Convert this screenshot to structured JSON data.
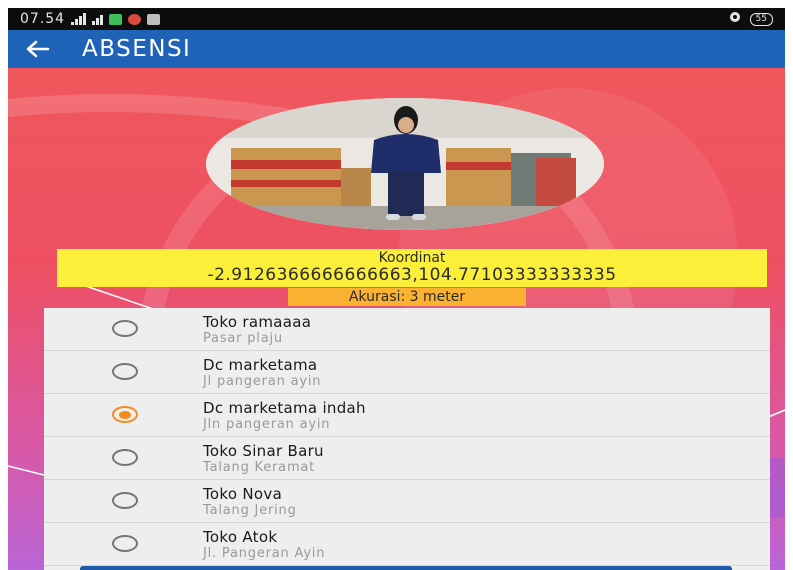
{
  "status_bar": {
    "time": "07.54",
    "battery": "55"
  },
  "app_bar": {
    "title": "ABSENSI"
  },
  "location": {
    "coord_label": "Koordinat",
    "coord_value": "-2.9126366666666663,104.77103333333335",
    "accuracy": "Akurasi: 3 meter"
  },
  "stores": [
    {
      "name": "Toko ramaaaa",
      "address": "Pasar plaju",
      "selected": false
    },
    {
      "name": "Dc marketama",
      "address": "Jl pangeran ayin",
      "selected": false
    },
    {
      "name": "Dc marketama indah",
      "address": "Jln pangeran ayin",
      "selected": true
    },
    {
      "name": "Toko Sinar Baru",
      "address": "Talang Keramat",
      "selected": false
    },
    {
      "name": "Toko Nova",
      "address": "Talang Jering",
      "selected": false
    },
    {
      "name": "Toko Atok",
      "address": "Jl. Pangeran Ayin",
      "selected": false
    }
  ],
  "colors": {
    "app_bar": "#1e63b8",
    "coord_bg": "#fcef3a",
    "accuracy_bg": "#fbb233",
    "radio_selected": "#f58a1e"
  }
}
